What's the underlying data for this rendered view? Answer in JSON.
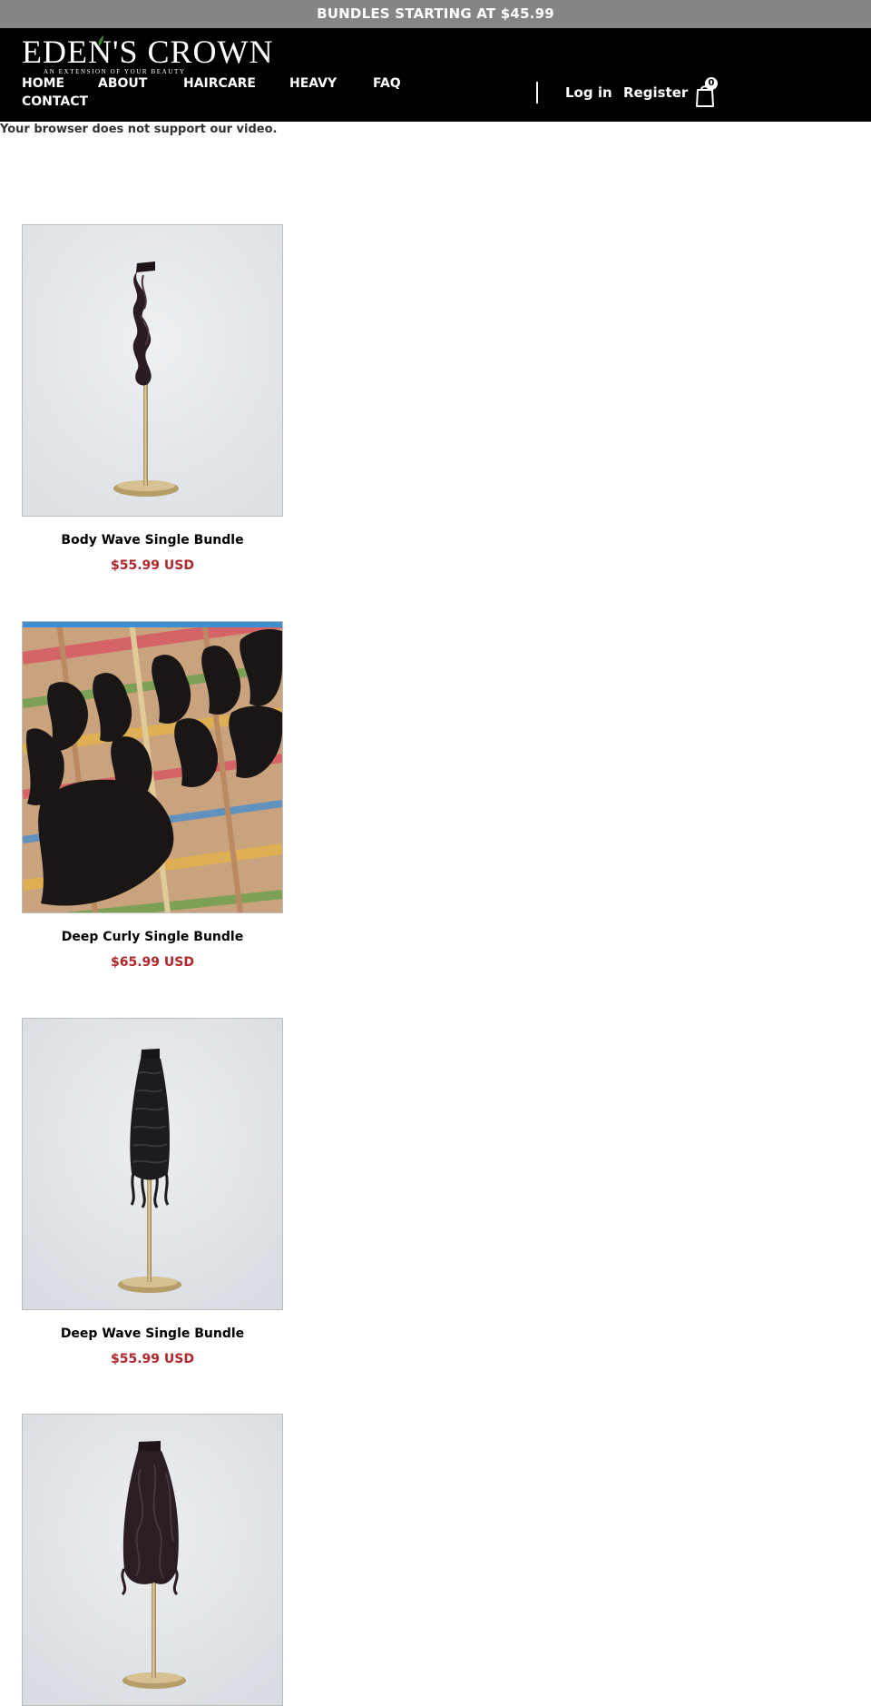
{
  "announcement": {
    "text": "BUNDLES STARTING AT $45.99"
  },
  "brand": {
    "name": "EDEN'S CROWN",
    "tagline": "AN EXTENSION OF YOUR BEAUTY",
    "leaf_color": "#3c8a2e"
  },
  "nav": {
    "items": [
      {
        "label": "HOME"
      },
      {
        "label": "ABOUT"
      },
      {
        "label": "HAIRCARE"
      },
      {
        "label": "HEAVY"
      },
      {
        "label": "FAQ"
      },
      {
        "label": "CONTACT"
      }
    ]
  },
  "account": {
    "login_label": "Log in",
    "register_label": "Register",
    "cart_count": "0",
    "cart_icon": "shopping-bag-icon"
  },
  "video": {
    "fallback_text": "Your browser does not support our video."
  },
  "colors": {
    "announcement_bg": "#858585",
    "header_bg": "#000000",
    "price": "#b0272d"
  },
  "products": [
    {
      "title": "Body Wave Single Bundle",
      "price": "$55.99 USD",
      "image": "body-wave-bundle-on-stand"
    },
    {
      "title": "Deep Curly Single Bundle",
      "price": "$65.99 USD",
      "image": "deep-curly-bundles-on-woven-mat"
    },
    {
      "title": "Deep Wave Single Bundle",
      "price": "$55.99 USD",
      "image": "deep-wave-bundle-on-stand"
    },
    {
      "title": "",
      "price": "",
      "image": "loose-wave-bundle-on-stand"
    }
  ]
}
